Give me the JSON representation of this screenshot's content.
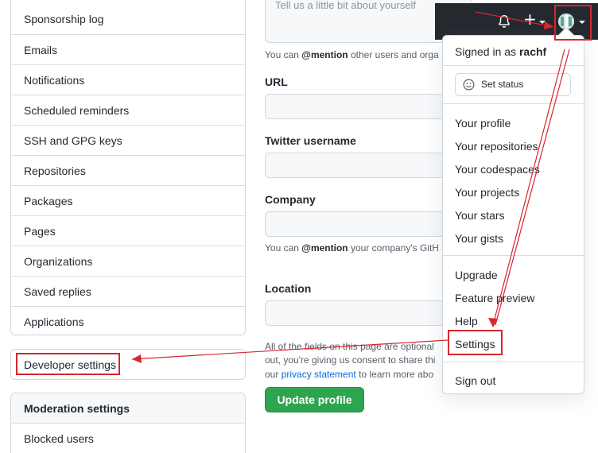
{
  "sidebar": {
    "items": [
      {
        "label": "Sponsorship log"
      },
      {
        "label": "Emails"
      },
      {
        "label": "Notifications"
      },
      {
        "label": "Scheduled reminders"
      },
      {
        "label": "SSH and GPG keys"
      },
      {
        "label": "Repositories"
      },
      {
        "label": "Packages"
      },
      {
        "label": "Pages"
      },
      {
        "label": "Organizations"
      },
      {
        "label": "Saved replies"
      },
      {
        "label": "Applications"
      }
    ],
    "developer_settings": "Developer settings",
    "moderation_header": "Moderation settings",
    "blocked_users": "Blocked users"
  },
  "form": {
    "bio_placeholder": "Tell us a little bit about yourself",
    "bio_note_pre": "You can ",
    "bio_note_mention": "@mention",
    "bio_note_post": " other users and orga",
    "url_label": "URL",
    "twitter_label": "Twitter username",
    "company_label": "Company",
    "company_note_pre": "You can ",
    "company_note_mention": "@mention",
    "company_note_post": " your company's GitH",
    "location_label": "Location",
    "consent_line1": "All of the fields on this page are optional",
    "consent_line2": "out, you're giving us consent to share thi",
    "consent_line3_pre": "our ",
    "consent_link": "privacy statement",
    "consent_line3_post": " to learn more abo",
    "update_button": "Update profile"
  },
  "header": {
    "plus": "+"
  },
  "dropdown": {
    "signed_in_prefix": "Signed in as ",
    "username": "rachf",
    "set_status": "Set status",
    "profile_items": [
      "Your profile",
      "Your repositories",
      "Your codespaces",
      "Your projects",
      "Your stars",
      "Your gists"
    ],
    "upgrade": "Upgrade",
    "feature_preview": "Feature preview",
    "help": "Help",
    "settings": "Settings",
    "sign_out": "Sign out"
  },
  "colors": {
    "annotation_red": "#d7262e",
    "header_bg": "#24292f",
    "button_green": "#2da44e",
    "link_blue": "#0969da"
  }
}
